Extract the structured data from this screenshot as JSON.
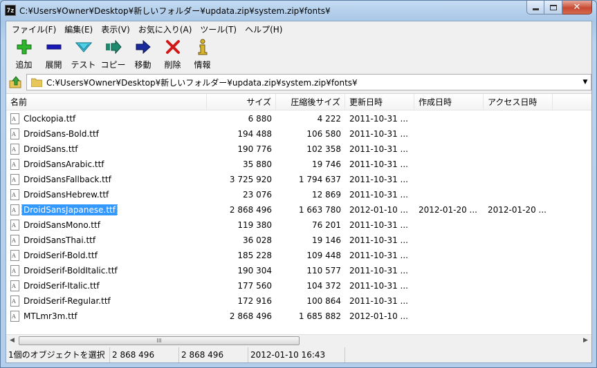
{
  "window": {
    "title": "C:¥Users¥Owner¥Desktop¥新しいフォルダー¥updata.zip¥system.zip¥fonts¥",
    "app_icon_text": "7z"
  },
  "menu": [
    "ファイル(F)",
    "編集(E)",
    "表示(V)",
    "お気に入り(A)",
    "ツール(T)",
    "ヘルプ(H)"
  ],
  "toolbar": [
    {
      "label": "追加",
      "icon": "add-icon",
      "color": "#2db52d"
    },
    {
      "label": "展開",
      "icon": "extract-icon",
      "color": "#1a1ab8"
    },
    {
      "label": "テスト",
      "icon": "test-icon",
      "color": "#1fa3c4"
    },
    {
      "label": "コピー",
      "icon": "copy-icon",
      "color": "#1e8a6e"
    },
    {
      "label": "移動",
      "icon": "move-icon",
      "color": "#1a2a9c"
    },
    {
      "label": "削除",
      "icon": "delete-icon",
      "color": "#d01818"
    },
    {
      "label": "情報",
      "icon": "info-icon",
      "color": "#d8b52a"
    }
  ],
  "address": {
    "path": "C:¥Users¥Owner¥Desktop¥新しいフォルダー¥updata.zip¥system.zip¥fonts¥"
  },
  "columns": [
    "名前",
    "サイズ",
    "圧縮後サイズ",
    "更新日時",
    "作成日時",
    "アクセス日時"
  ],
  "files": [
    {
      "name": "Clockopia.ttf",
      "size": "6 880",
      "packed": "4 222",
      "modified": "2011-10-31 ...",
      "created": "",
      "accessed": ""
    },
    {
      "name": "DroidSans-Bold.ttf",
      "size": "194 488",
      "packed": "106 580",
      "modified": "2011-10-31 ...",
      "created": "",
      "accessed": ""
    },
    {
      "name": "DroidSans.ttf",
      "size": "190 776",
      "packed": "102 358",
      "modified": "2011-10-31 ...",
      "created": "",
      "accessed": ""
    },
    {
      "name": "DroidSansArabic.ttf",
      "size": "35 880",
      "packed": "19 746",
      "modified": "2011-10-31 ...",
      "created": "",
      "accessed": ""
    },
    {
      "name": "DroidSansFallback.ttf",
      "size": "3 725 920",
      "packed": "1 794 637",
      "modified": "2011-10-31 ...",
      "created": "",
      "accessed": ""
    },
    {
      "name": "DroidSansHebrew.ttf",
      "size": "23 076",
      "packed": "12 869",
      "modified": "2011-10-31 ...",
      "created": "",
      "accessed": ""
    },
    {
      "name": "DroidSansJapanese.ttf",
      "size": "2 868 496",
      "packed": "1 663 780",
      "modified": "2012-01-10 ...",
      "created": "2012-01-20 ...",
      "accessed": "2012-01-20 ...",
      "selected": true
    },
    {
      "name": "DroidSansMono.ttf",
      "size": "119 380",
      "packed": "76 201",
      "modified": "2011-10-31 ...",
      "created": "",
      "accessed": ""
    },
    {
      "name": "DroidSansThai.ttf",
      "size": "36 028",
      "packed": "19 146",
      "modified": "2011-10-31 ...",
      "created": "",
      "accessed": ""
    },
    {
      "name": "DroidSerif-Bold.ttf",
      "size": "185 228",
      "packed": "109 448",
      "modified": "2011-10-31 ...",
      "created": "",
      "accessed": ""
    },
    {
      "name": "DroidSerif-BoldItalic.ttf",
      "size": "190 304",
      "packed": "110 577",
      "modified": "2011-10-31 ...",
      "created": "",
      "accessed": ""
    },
    {
      "name": "DroidSerif-Italic.ttf",
      "size": "177 560",
      "packed": "104 372",
      "modified": "2011-10-31 ...",
      "created": "",
      "accessed": ""
    },
    {
      "name": "DroidSerif-Regular.ttf",
      "size": "172 916",
      "packed": "100 864",
      "modified": "2011-10-31 ...",
      "created": "",
      "accessed": ""
    },
    {
      "name": "MTLmr3m.ttf",
      "size": "2 868 496",
      "packed": "1 685 882",
      "modified": "2012-01-10 ...",
      "created": "",
      "accessed": ""
    }
  ],
  "scrollbar": {
    "thumb_grip": "III"
  },
  "status": {
    "selection": "1個のオブジェクトを選択",
    "size": "2 868 496",
    "packed": "2 868 496",
    "datetime": "2012-01-10 16:43"
  }
}
